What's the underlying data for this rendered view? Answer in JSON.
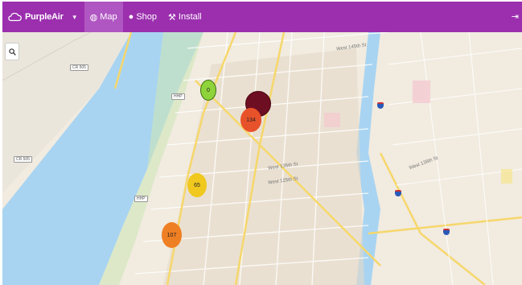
{
  "nav": {
    "brand": "PurpleAir",
    "items": [
      {
        "label": "Map",
        "icon": "globe-icon",
        "active": true
      },
      {
        "label": "Shop",
        "icon": "location-pin-icon",
        "active": false
      },
      {
        "label": "Install",
        "icon": "wrench-icon",
        "active": false
      }
    ],
    "right_icon": "sign-in-icon"
  },
  "map": {
    "markers": [
      {
        "value": "0",
        "color": "#8fd33a",
        "border": "#3d6f10"
      },
      {
        "value": "134",
        "color": "#e8522a",
        "border": "#e8522a"
      },
      {
        "value": "65",
        "color": "#f0c81e",
        "border": "#f0c81e"
      },
      {
        "value": "107",
        "color": "#ef7f23",
        "border": "#ef7f23"
      }
    ],
    "road_labels": {
      "cr505_top": "CR 505",
      "cr505_left": "CR 505",
      "hhp_top": "HHP",
      "hhp_bottom": "HHP",
      "w125": "West 125th St",
      "w135": "West 135th St",
      "w138": "West 138th St",
      "w145": "West 145th St"
    }
  }
}
